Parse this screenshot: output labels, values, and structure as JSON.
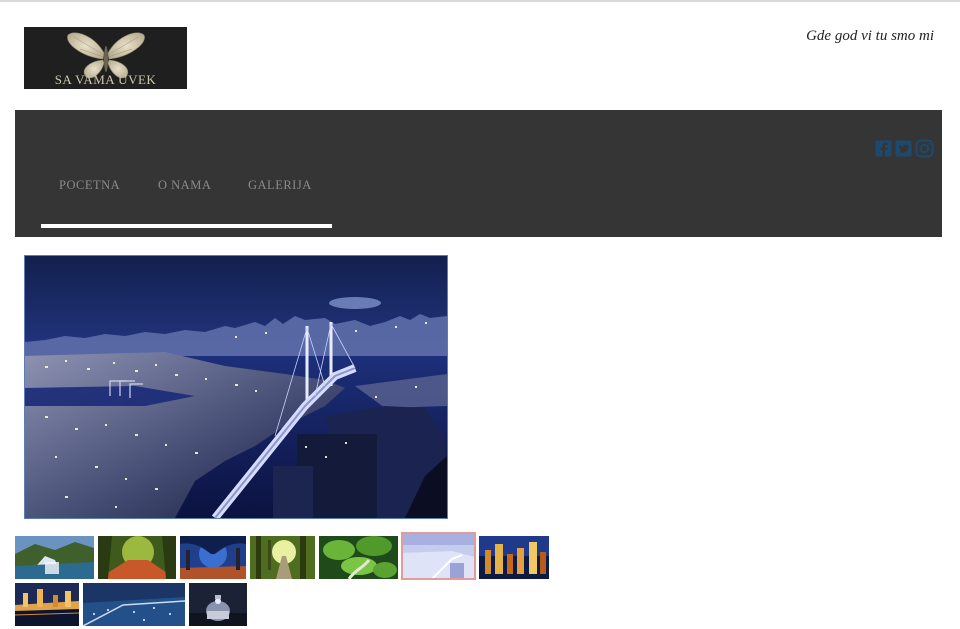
{
  "header": {
    "logo_text": "SA VAMA UVEK",
    "tagline": "Gde god vi tu smo mi"
  },
  "nav": {
    "items": [
      {
        "label": "POCETNA"
      },
      {
        "label": "O NAMA"
      },
      {
        "label": "GALERIJA"
      }
    ],
    "social": [
      "facebook-icon",
      "twitter-icon",
      "instagram-icon"
    ],
    "social_color": "#1c4a6e"
  },
  "gallery": {
    "selected_index": 5,
    "thumbnail_count": 10
  },
  "colors": {
    "navbar": "#353535",
    "logo_bg": "#1f1f1f",
    "active_thumb_border": "#e39a9a"
  }
}
